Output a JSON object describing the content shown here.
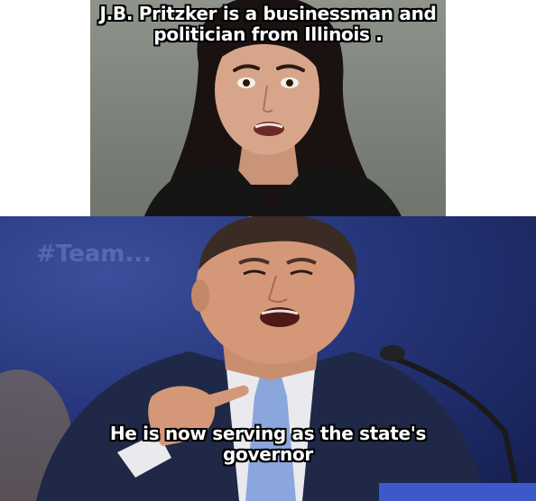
{
  "captions": {
    "top": {
      "line1": "J.B. Pritzker is a businessman and",
      "line2": "politician from Illinois ."
    },
    "bottom": {
      "line1": "He is now serving as the state's",
      "line2": "governor"
    }
  },
  "background_sign_text": "#Team..."
}
